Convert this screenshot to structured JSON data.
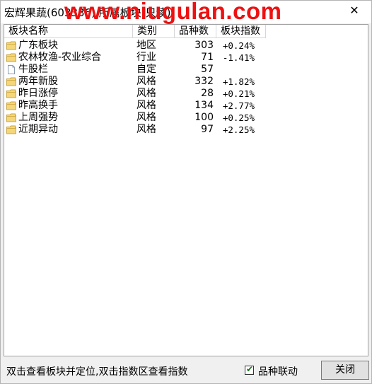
{
  "window": {
    "title": "宏辉果蔬(603336) 所属板块(只读)",
    "watermark": "www.niugulan.com",
    "close_symbol": "✕"
  },
  "table": {
    "headers": {
      "name": "板块名称",
      "type": "类别",
      "count": "品种数",
      "index": "板块指数"
    },
    "rows": [
      {
        "icon": "folder-icon",
        "name": "广东板块",
        "type": "地区",
        "count": "303",
        "index": "+0.24%"
      },
      {
        "icon": "folder-icon",
        "name": "农林牧渔-农业综合",
        "type": "行业",
        "count": "71",
        "index": "-1.41%"
      },
      {
        "icon": "document-icon",
        "name": "牛股栏",
        "type": "自定",
        "count": "57",
        "index": ""
      },
      {
        "icon": "folder-icon",
        "name": "两年新股",
        "type": "风格",
        "count": "332",
        "index": "+1.82%"
      },
      {
        "icon": "folder-icon",
        "name": "昨日涨停",
        "type": "风格",
        "count": "28",
        "index": "+0.21%"
      },
      {
        "icon": "folder-icon",
        "name": "昨高换手",
        "type": "风格",
        "count": "134",
        "index": "+2.77%"
      },
      {
        "icon": "folder-icon",
        "name": "上周强势",
        "type": "风格",
        "count": "100",
        "index": "+0.25%"
      },
      {
        "icon": "folder-icon",
        "name": "近期异动",
        "type": "风格",
        "count": "97",
        "index": "+2.25%"
      }
    ]
  },
  "footer": {
    "hint": "双击查看板块并定位,双击指数区查看指数",
    "checkbox_label": "品种联动",
    "checkbox_checked": true,
    "close_label": "关闭"
  },
  "colors": {
    "folder": "#f5d67a",
    "folder_edge": "#c9a43a",
    "watermark": "#ee1111"
  }
}
